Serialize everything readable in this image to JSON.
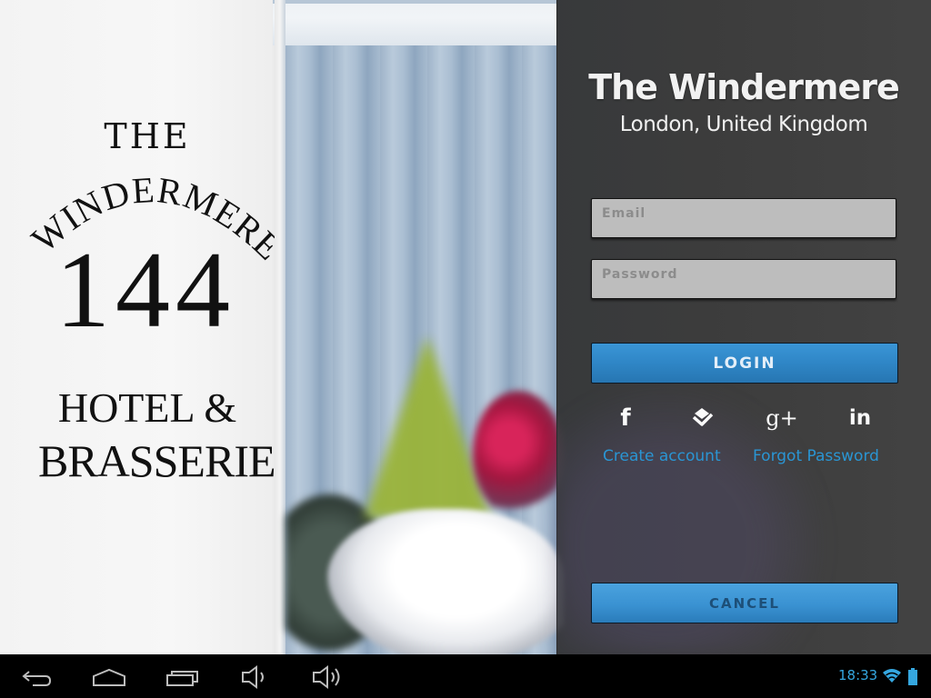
{
  "background": {
    "sign": {
      "line1": "THE",
      "line2": "WINDERMERE",
      "number": "144",
      "line3": "HOTEL &",
      "line4": "BRASSERIE"
    }
  },
  "login_panel": {
    "title": "The Windermere",
    "subtitle": "London, United Kingdom",
    "email": {
      "placeholder": "Email",
      "value": ""
    },
    "password": {
      "placeholder": "Password",
      "value": ""
    },
    "login_label": "LOGIN",
    "social": [
      {
        "name": "facebook",
        "glyph": "f"
      },
      {
        "name": "foursquare",
        "glyph": ""
      },
      {
        "name": "google-plus",
        "glyph": "g+"
      },
      {
        "name": "linkedin",
        "glyph": "in"
      }
    ],
    "create_account_label": "Create account",
    "forgot_password_label": "Forgot Password",
    "cancel_label": "CANCEL",
    "colors": {
      "button_blue": "#2f86c6",
      "link_blue": "#2a95d3",
      "field_gray": "#bdbdbd"
    }
  },
  "system_bar": {
    "buttons": [
      "back",
      "home",
      "recent-apps",
      "volume-down",
      "volume-up"
    ],
    "time": "18:33",
    "status_color": "#35a7e0"
  }
}
